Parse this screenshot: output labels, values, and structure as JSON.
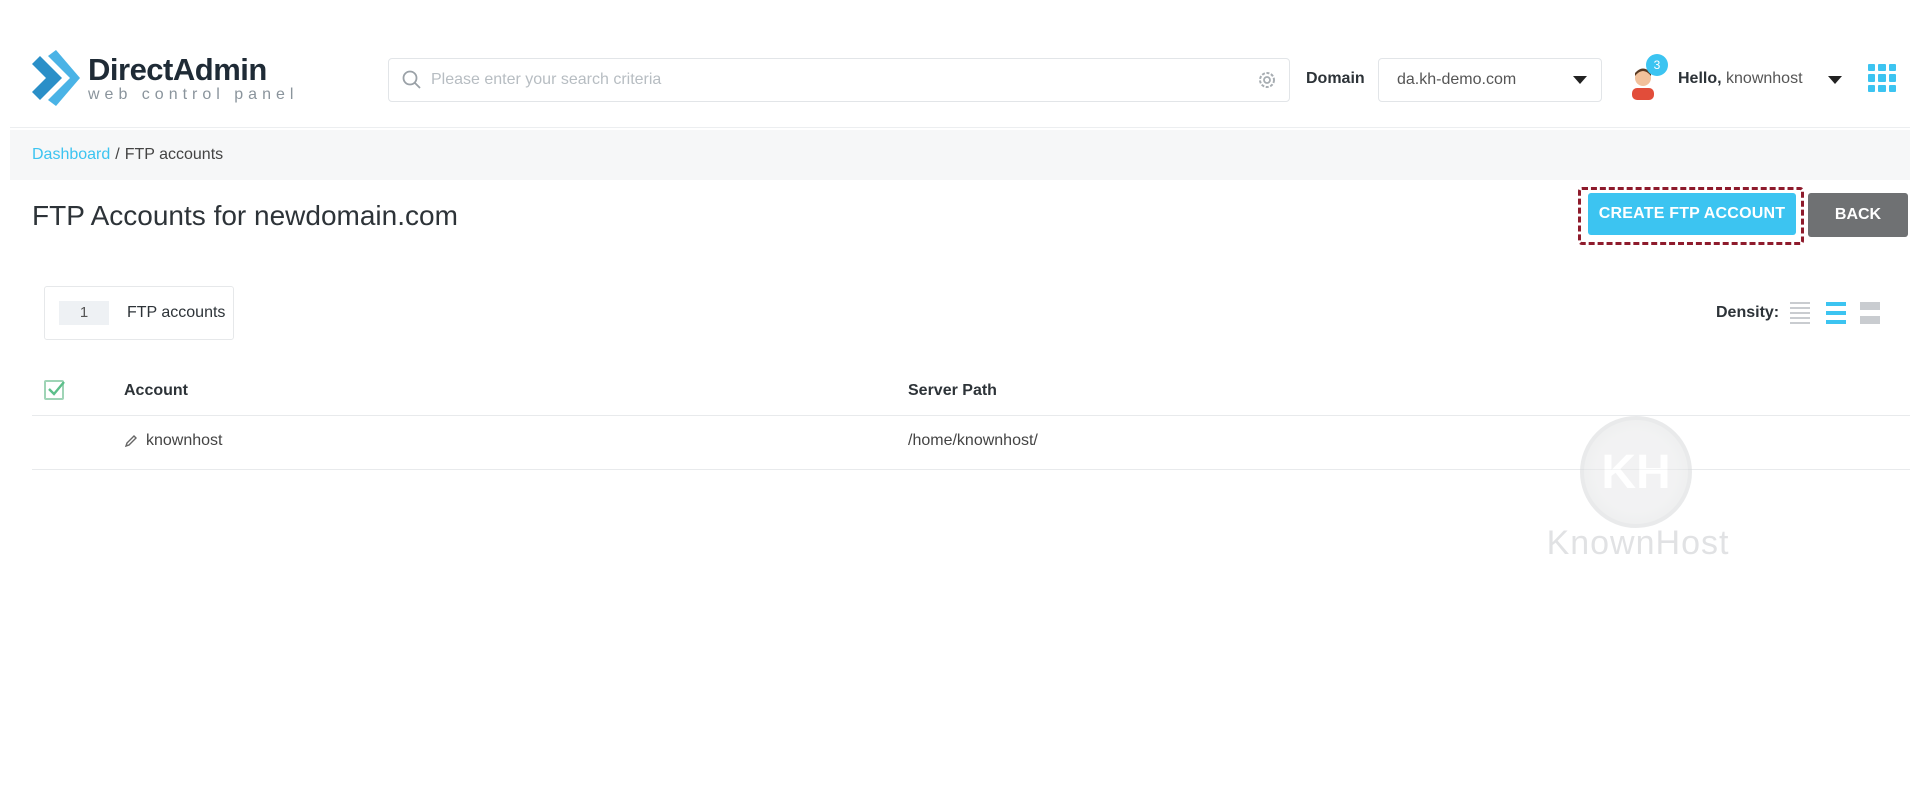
{
  "app": {
    "logo_title": "DirectAdmin",
    "logo_subtitle": "web control panel"
  },
  "search": {
    "placeholder": "Please enter your search criteria"
  },
  "domain": {
    "label": "Domain",
    "selected": "da.kh-demo.com"
  },
  "user": {
    "notification_count": "3",
    "greeting": "Hello,",
    "username": "knownhost"
  },
  "breadcrumb": {
    "items": [
      "Dashboard",
      "/",
      "FTP accounts"
    ]
  },
  "page": {
    "title": "FTP Accounts for newdomain.com",
    "create_button": "CREATE FTP ACCOUNT",
    "back_button": "BACK"
  },
  "summary": {
    "count": "1",
    "label": "FTP accounts"
  },
  "density": {
    "label": "Density:",
    "options": [
      "compact",
      "normal",
      "comfortable"
    ],
    "selected": "normal"
  },
  "table": {
    "headers": [
      "Account",
      "Server Path"
    ],
    "rows": [
      {
        "account": "knownhost",
        "server_path": "/home/knownhost/"
      }
    ]
  },
  "watermark": {
    "monogram": "KH",
    "text": "KnownHost"
  },
  "colors": {
    "accent": "#3cc4f1",
    "back_button": "#6f7173",
    "highlight_border": "#8e1b2c"
  }
}
